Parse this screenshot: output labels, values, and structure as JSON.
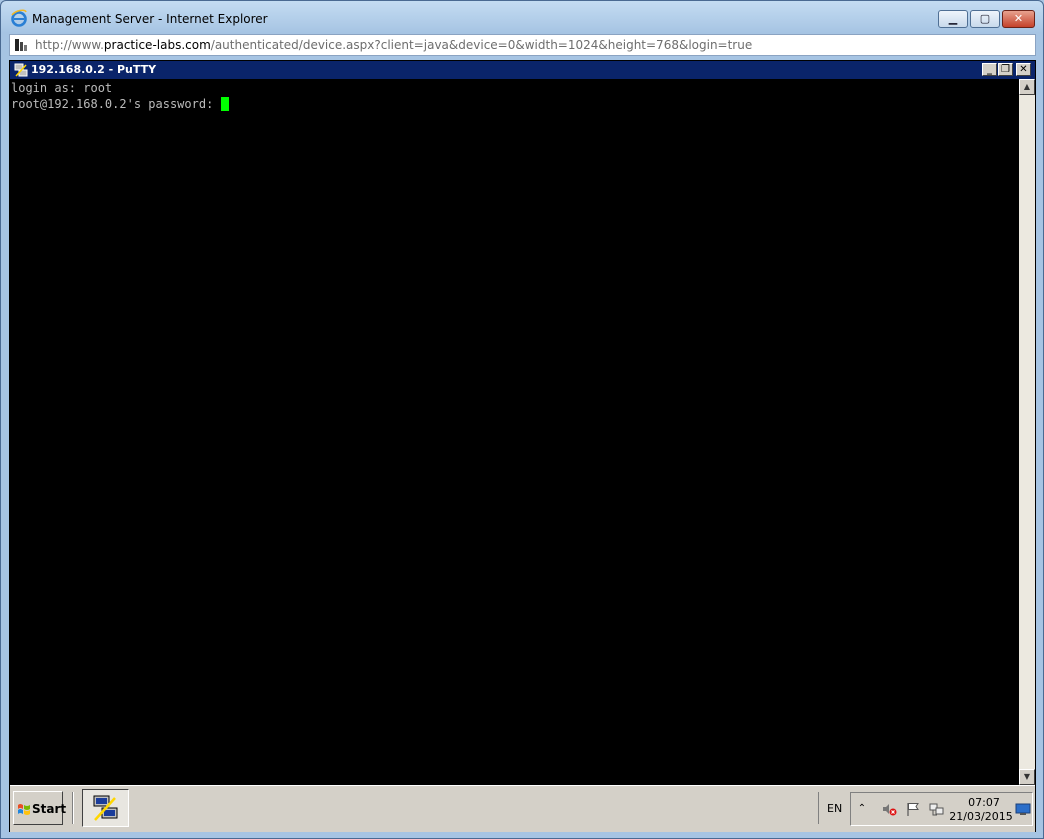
{
  "browser": {
    "title": "Management Server - Internet Explorer",
    "url_prefix": "http://www.",
    "url_domain": "practice-labs.com",
    "url_path": "/authenticated/device.aspx?client=java&device=0&width=1024&height=768&login=true",
    "icons": [
      "ie-logo-icon",
      "site-icon",
      "minimize-icon",
      "maximize-icon",
      "close-icon"
    ]
  },
  "putty": {
    "title": "192.168.0.2 - PuTTY",
    "lines": [
      "login as: root",
      "root@192.168.0.2's password: "
    ],
    "colors": {
      "background": "#000000",
      "text": "#bbbbbb",
      "cursor": "#00ff00",
      "titlebar": "#0a246a"
    }
  },
  "taskbar": {
    "start_label": "Start",
    "language": "EN",
    "time": "07:07",
    "date": "21/03/2015",
    "tray_icons": [
      "chevron-up-icon",
      "speaker-muted-icon",
      "flag-icon",
      "network-icon",
      "show-desktop-icon"
    ]
  }
}
